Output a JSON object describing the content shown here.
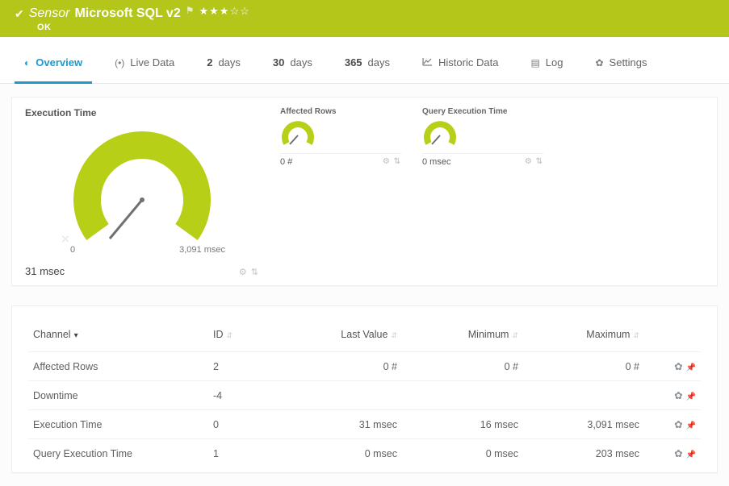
{
  "header": {
    "type_label": "Sensor",
    "name": "Microsoft SQL v2",
    "status": "OK",
    "rating": 3
  },
  "tabs": {
    "overview": "Overview",
    "live": "Live Data",
    "two": {
      "num": "2",
      "unit": "days"
    },
    "thirty": {
      "num": "30",
      "unit": "days"
    },
    "year": {
      "num": "365",
      "unit": "days"
    },
    "historic": "Historic Data",
    "log": "Log",
    "settings": "Settings"
  },
  "gauges": {
    "main": {
      "title": "Execution Time",
      "min_label": "0",
      "max_label": "3,091 msec",
      "current": "31 msec"
    },
    "affected": {
      "title": "Affected Rows",
      "value": "0 #"
    },
    "qet": {
      "title": "Query Execution Time",
      "value": "0 msec"
    }
  },
  "table": {
    "headers": {
      "channel": "Channel",
      "id": "ID",
      "last": "Last Value",
      "min": "Minimum",
      "max": "Maximum"
    },
    "rows": [
      {
        "channel": "Affected Rows",
        "id": "2",
        "last": "0 #",
        "min": "0 #",
        "max": "0 #"
      },
      {
        "channel": "Downtime",
        "id": "-4",
        "last": "",
        "min": "",
        "max": ""
      },
      {
        "channel": "Execution Time",
        "id": "0",
        "last": "31 msec",
        "min": "16 msec",
        "max": "3,091 msec"
      },
      {
        "channel": "Query Execution Time",
        "id": "1",
        "last": "0 msec",
        "min": "0 msec",
        "max": "203 msec"
      }
    ]
  },
  "chart_data": [
    {
      "type": "gauge",
      "title": "Execution Time",
      "value": 31,
      "min": 0,
      "max": 3091,
      "unit": "msec"
    },
    {
      "type": "gauge",
      "title": "Affected Rows",
      "value": 0,
      "min": 0,
      "max": 0,
      "unit": "#"
    },
    {
      "type": "gauge",
      "title": "Query Execution Time",
      "value": 0,
      "min": 0,
      "max": 0,
      "unit": "msec"
    }
  ]
}
